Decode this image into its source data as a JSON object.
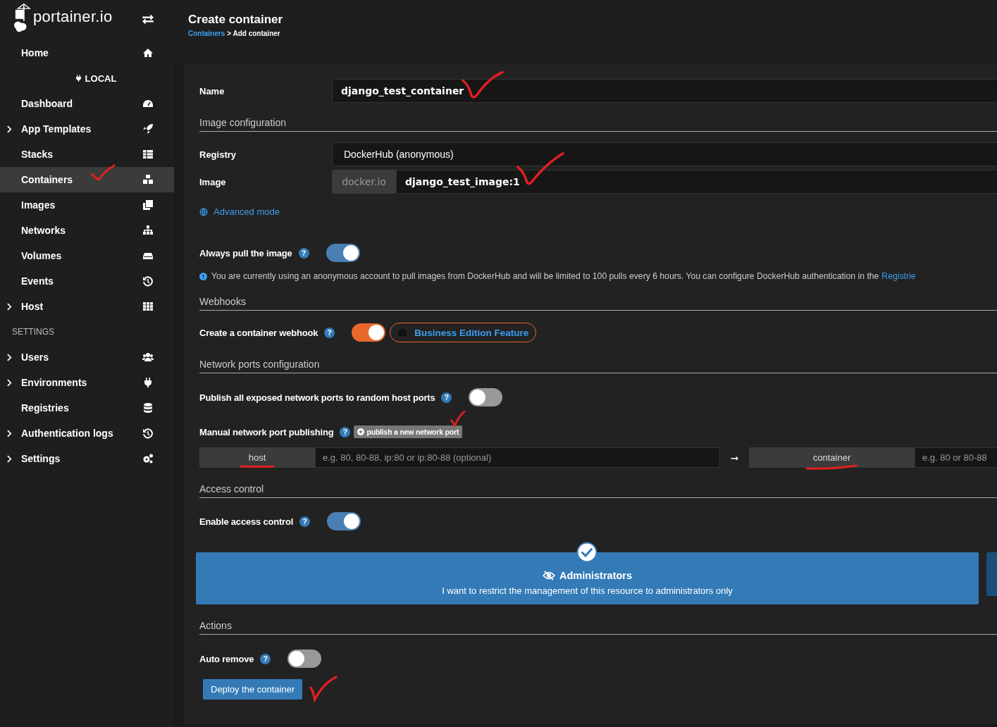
{
  "sidebar": {
    "logo_text": "portainer.io",
    "items": [
      {
        "kind": "item",
        "label": "Home",
        "expandable": false,
        "selected": false
      },
      {
        "kind": "environment",
        "label": "LOCAL"
      },
      {
        "kind": "item",
        "label": "Dashboard",
        "expandable": false,
        "selected": false
      },
      {
        "kind": "item",
        "label": "App Templates",
        "expandable": true,
        "selected": false
      },
      {
        "kind": "item",
        "label": "Stacks",
        "expandable": false,
        "selected": false
      },
      {
        "kind": "item",
        "label": "Containers",
        "expandable": false,
        "selected": true
      },
      {
        "kind": "item",
        "label": "Images",
        "expandable": false,
        "selected": false
      },
      {
        "kind": "item",
        "label": "Networks",
        "expandable": false,
        "selected": false
      },
      {
        "kind": "item",
        "label": "Volumes",
        "expandable": false,
        "selected": false
      },
      {
        "kind": "item",
        "label": "Events",
        "expandable": false,
        "selected": false
      },
      {
        "kind": "item",
        "label": "Host",
        "expandable": true,
        "selected": false
      },
      {
        "kind": "heading",
        "label": "SETTINGS"
      },
      {
        "kind": "item",
        "label": "Users",
        "expandable": true,
        "selected": false
      },
      {
        "kind": "item",
        "label": "Environments",
        "expandable": true,
        "selected": false
      },
      {
        "kind": "item",
        "label": "Registries",
        "expandable": false,
        "selected": false
      },
      {
        "kind": "item",
        "label": "Authentication logs",
        "expandable": true,
        "selected": false
      },
      {
        "kind": "item",
        "label": "Settings",
        "expandable": true,
        "selected": false
      }
    ]
  },
  "header": {
    "title": "Create container",
    "breadcrumb_link": "Containers",
    "breadcrumb_current": "> Add container"
  },
  "name": {
    "label": "Name",
    "value": "django_test_container"
  },
  "image_config": {
    "heading": "Image configuration",
    "registry": {
      "label": "Registry",
      "value": "DockerHub (anonymous)"
    },
    "image": {
      "label": "Image",
      "prefix": "docker.io",
      "value": "django_test_image:1"
    },
    "advanced_link": "Advanced mode"
  },
  "always_pull": {
    "label": "Always pull the image",
    "help": "?",
    "on": true
  },
  "notice": {
    "text": "You are currently using an anonymous account to pull images from DockerHub and will be limited to 100 pulls every 6 hours. You can configure DockerHub authentication in the",
    "link": "Registrie"
  },
  "webhooks": {
    "heading": "Webhooks",
    "toggle": {
      "label": "Create a container webhook",
      "help": "?",
      "on": true
    },
    "badge": "Business Edition Feature"
  },
  "ports": {
    "heading": "Network ports configuration",
    "publish_all": {
      "label": "Publish all exposed network ports to random host ports",
      "help": "?",
      "on": false
    },
    "manual_label": "Manual network port publishing",
    "manual_help": "?",
    "add_button": "publish a new network port",
    "host_label": "host",
    "host_placeholder": "e.g. 80, 80-88, ip:80 or ip:80-88 (optional)",
    "arrow": "➞",
    "container_label": "container",
    "container_placeholder": "e.g. 80 or 80-88"
  },
  "access": {
    "heading": "Access control",
    "toggle": {
      "label": "Enable access control",
      "help": "?",
      "on": true
    },
    "option": {
      "title": "Administrators",
      "description": "I want to restrict the management of this resource to administrators only",
      "selected": true
    }
  },
  "actions": {
    "heading": "Actions",
    "auto_remove": {
      "label": "Auto remove",
      "help": "?",
      "on": false
    },
    "deploy": "Deploy the container"
  }
}
